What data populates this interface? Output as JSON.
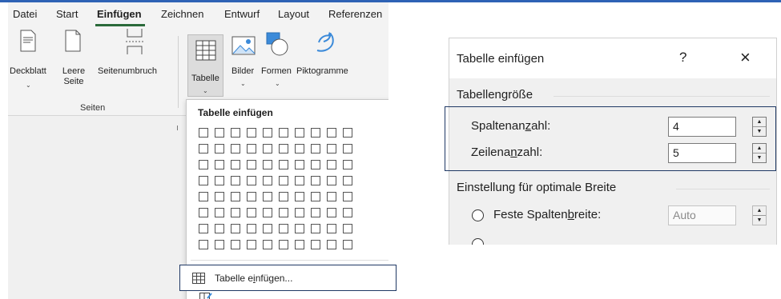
{
  "menubar": {
    "items": [
      "Datei",
      "Start",
      "Einfügen",
      "Zeichnen",
      "Entwurf",
      "Layout",
      "Referenzen"
    ],
    "active": "Einfügen"
  },
  "ribbon": {
    "deckblatt_label": "Deckblatt",
    "leere_seite_label": "Leere Seite",
    "seitenumbruch_label": "Seitenumbruch",
    "tabelle_label": "Tabelle",
    "bilder_label": "Bilder",
    "formen_label": "Formen",
    "piktogramme_label": "Piktogramme",
    "group_seiten": "Seiten",
    "accent_color": "#2b6a3a"
  },
  "dropdown": {
    "title": "Tabelle einfügen",
    "grid_cols": 10,
    "grid_rows": 8,
    "item_label_pre": "Tabelle e",
    "item_label_u": "i",
    "item_label_post": "nfügen...",
    "item2_icon": "draw-table-icon"
  },
  "dialog": {
    "title": "Tabelle einfügen",
    "help": "?",
    "close": "×",
    "section_size": "Tabellengröße",
    "spalten_pre": "Spaltenan",
    "spalten_u": "z",
    "spalten_post": "ahl:",
    "spalten_value": "4",
    "zeilen_pre": "Zeilena",
    "zeilen_u": "n",
    "zeilen_post": "zahl:",
    "zeilen_value": "5",
    "section_width": "Einstellung für optimale Breite",
    "feste_pre": "Feste Spalten",
    "feste_u": "b",
    "feste_post": "reite:",
    "feste_value": "Auto"
  }
}
